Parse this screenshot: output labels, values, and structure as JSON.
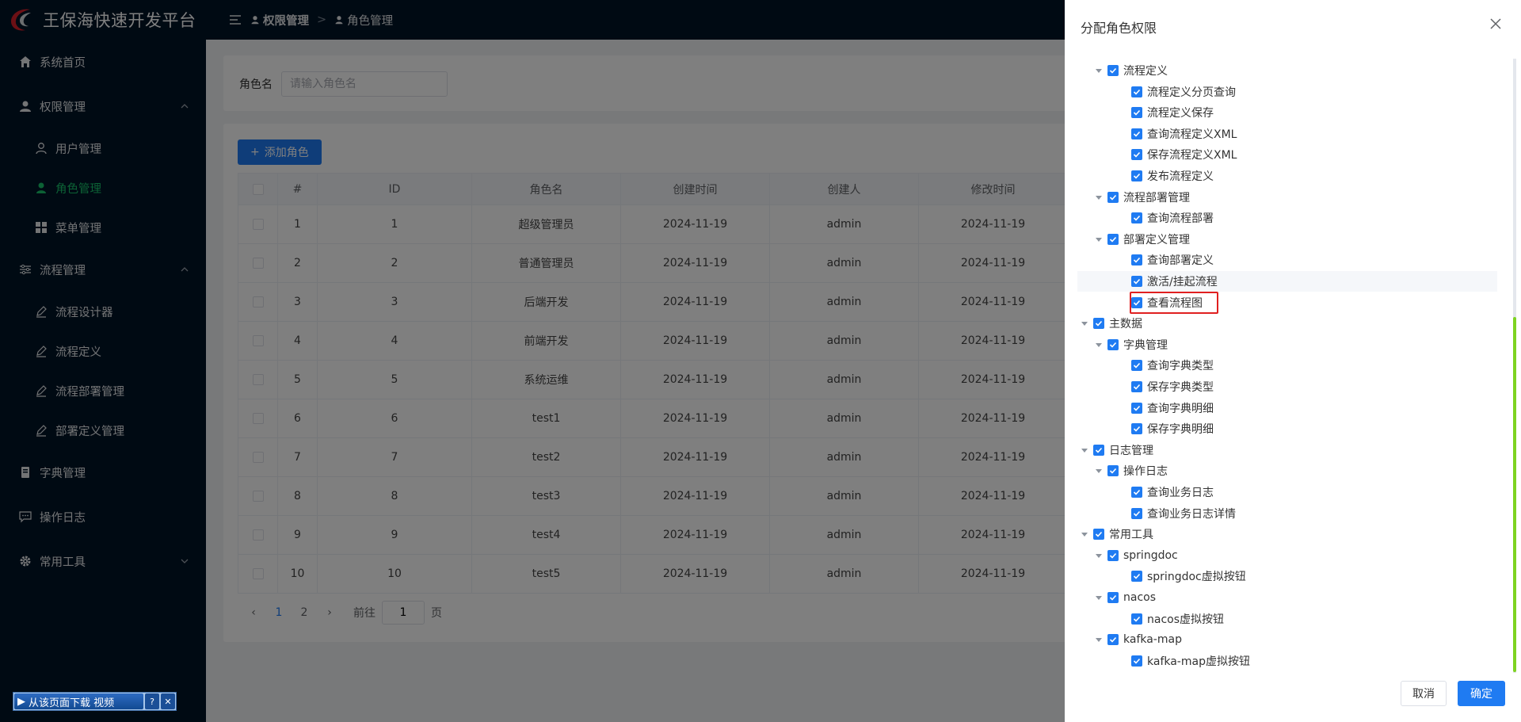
{
  "app": {
    "title": "王保海快速开发平台"
  },
  "sidebar": {
    "items": [
      {
        "label": "系统首页",
        "icon": "home-icon"
      },
      {
        "label": "权限管理",
        "icon": "person-icon",
        "expanded": true
      },
      {
        "label": "用户管理",
        "icon": "user-outline-icon"
      },
      {
        "label": "角色管理",
        "icon": "user-solid-icon",
        "active": true
      },
      {
        "label": "菜单管理",
        "icon": "grid-icon"
      },
      {
        "label": "流程管理",
        "icon": "sliders-icon",
        "expanded": true
      },
      {
        "label": "流程设计器",
        "icon": "pen-icon"
      },
      {
        "label": "流程定义",
        "icon": "pen-icon"
      },
      {
        "label": "流程部署管理",
        "icon": "pen-icon"
      },
      {
        "label": "部署定义管理",
        "icon": "pen-icon"
      },
      {
        "label": "字典管理",
        "icon": "book-icon"
      },
      {
        "label": "操作日志",
        "icon": "message-icon"
      },
      {
        "label": "常用工具",
        "icon": "gear-icon"
      }
    ]
  },
  "breadcrumb": [
    "权限管理",
    "角色管理"
  ],
  "search": {
    "label": "角色名",
    "placeholder": "请输入角色名"
  },
  "toolbar": {
    "add_label": "添加角色"
  },
  "table": {
    "columns": [
      "#",
      "ID",
      "角色名",
      "创建时间",
      "创建人",
      "修改时间"
    ],
    "rows": [
      [
        "1",
        "1",
        "超级管理员",
        "2024-11-19",
        "admin",
        "2024-11-19"
      ],
      [
        "2",
        "2",
        "普通管理员",
        "2024-11-19",
        "admin",
        "2024-11-19"
      ],
      [
        "3",
        "3",
        "后端开发",
        "2024-11-19",
        "admin",
        "2024-11-19"
      ],
      [
        "4",
        "4",
        "前端开发",
        "2024-11-19",
        "admin",
        "2024-11-19"
      ],
      [
        "5",
        "5",
        "系统运维",
        "2024-11-19",
        "admin",
        "2024-11-19"
      ],
      [
        "6",
        "6",
        "test1",
        "2024-11-19",
        "admin",
        "2024-11-19"
      ],
      [
        "7",
        "7",
        "test2",
        "2024-11-19",
        "admin",
        "2024-11-19"
      ],
      [
        "8",
        "8",
        "test3",
        "2024-11-19",
        "admin",
        "2024-11-19"
      ],
      [
        "9",
        "9",
        "test4",
        "2024-11-19",
        "admin",
        "2024-11-19"
      ],
      [
        "10",
        "10",
        "test5",
        "2024-11-19",
        "admin",
        "2024-11-19"
      ]
    ]
  },
  "pagination": {
    "pages": [
      "1",
      "2"
    ],
    "current": "1",
    "goto_prefix": "前往",
    "goto_value": "1",
    "goto_suffix": "页"
  },
  "drawer": {
    "title": "分配角色权限",
    "cancel_label": "取消",
    "ok_label": "确定",
    "tree": [
      {
        "label": "流程定义",
        "level": 2,
        "expandable": true
      },
      {
        "label": "流程定义分页查询",
        "level": 3
      },
      {
        "label": "流程定义保存",
        "level": 3
      },
      {
        "label": "查询流程定义XML",
        "level": 3
      },
      {
        "label": "保存流程定义XML",
        "level": 3
      },
      {
        "label": "发布流程定义",
        "level": 3
      },
      {
        "label": "流程部署管理",
        "level": 2,
        "expandable": true
      },
      {
        "label": "查询流程部署",
        "level": 3
      },
      {
        "label": "部署定义管理",
        "level": 2,
        "expandable": true
      },
      {
        "label": "查询部署定义",
        "level": 3
      },
      {
        "label": "激活/挂起流程",
        "level": 3,
        "hovered": true
      },
      {
        "label": "查看流程图",
        "level": 3,
        "marked": true
      },
      {
        "label": "主数据",
        "level": 1,
        "expandable": true
      },
      {
        "label": "字典管理",
        "level": 2,
        "expandable": true
      },
      {
        "label": "查询字典类型",
        "level": 3
      },
      {
        "label": "保存字典类型",
        "level": 3
      },
      {
        "label": "查询字典明细",
        "level": 3
      },
      {
        "label": "保存字典明细",
        "level": 3
      },
      {
        "label": "日志管理",
        "level": 1,
        "expandable": true
      },
      {
        "label": "操作日志",
        "level": 2,
        "expandable": true
      },
      {
        "label": "查询业务日志",
        "level": 3
      },
      {
        "label": "查询业务日志详情",
        "level": 3
      },
      {
        "label": "常用工具",
        "level": 1,
        "expandable": true
      },
      {
        "label": "springdoc",
        "level": 2,
        "expandable": true
      },
      {
        "label": "springdoc虚拟按钮",
        "level": 3
      },
      {
        "label": "nacos",
        "level": 2,
        "expandable": true
      },
      {
        "label": "nacos虚拟按钮",
        "level": 3
      },
      {
        "label": "kafka-map",
        "level": 2,
        "expandable": true
      },
      {
        "label": "kafka-map虚拟按钮",
        "level": 3
      }
    ]
  },
  "download_widget": {
    "label": "从该页面下载 视频",
    "help": "?",
    "close": "✕"
  },
  "colors": {
    "primary": "#1f7bf2",
    "sidebar_bg": "#011427",
    "active_menu": "#19c26a",
    "marker": "#e02020"
  }
}
